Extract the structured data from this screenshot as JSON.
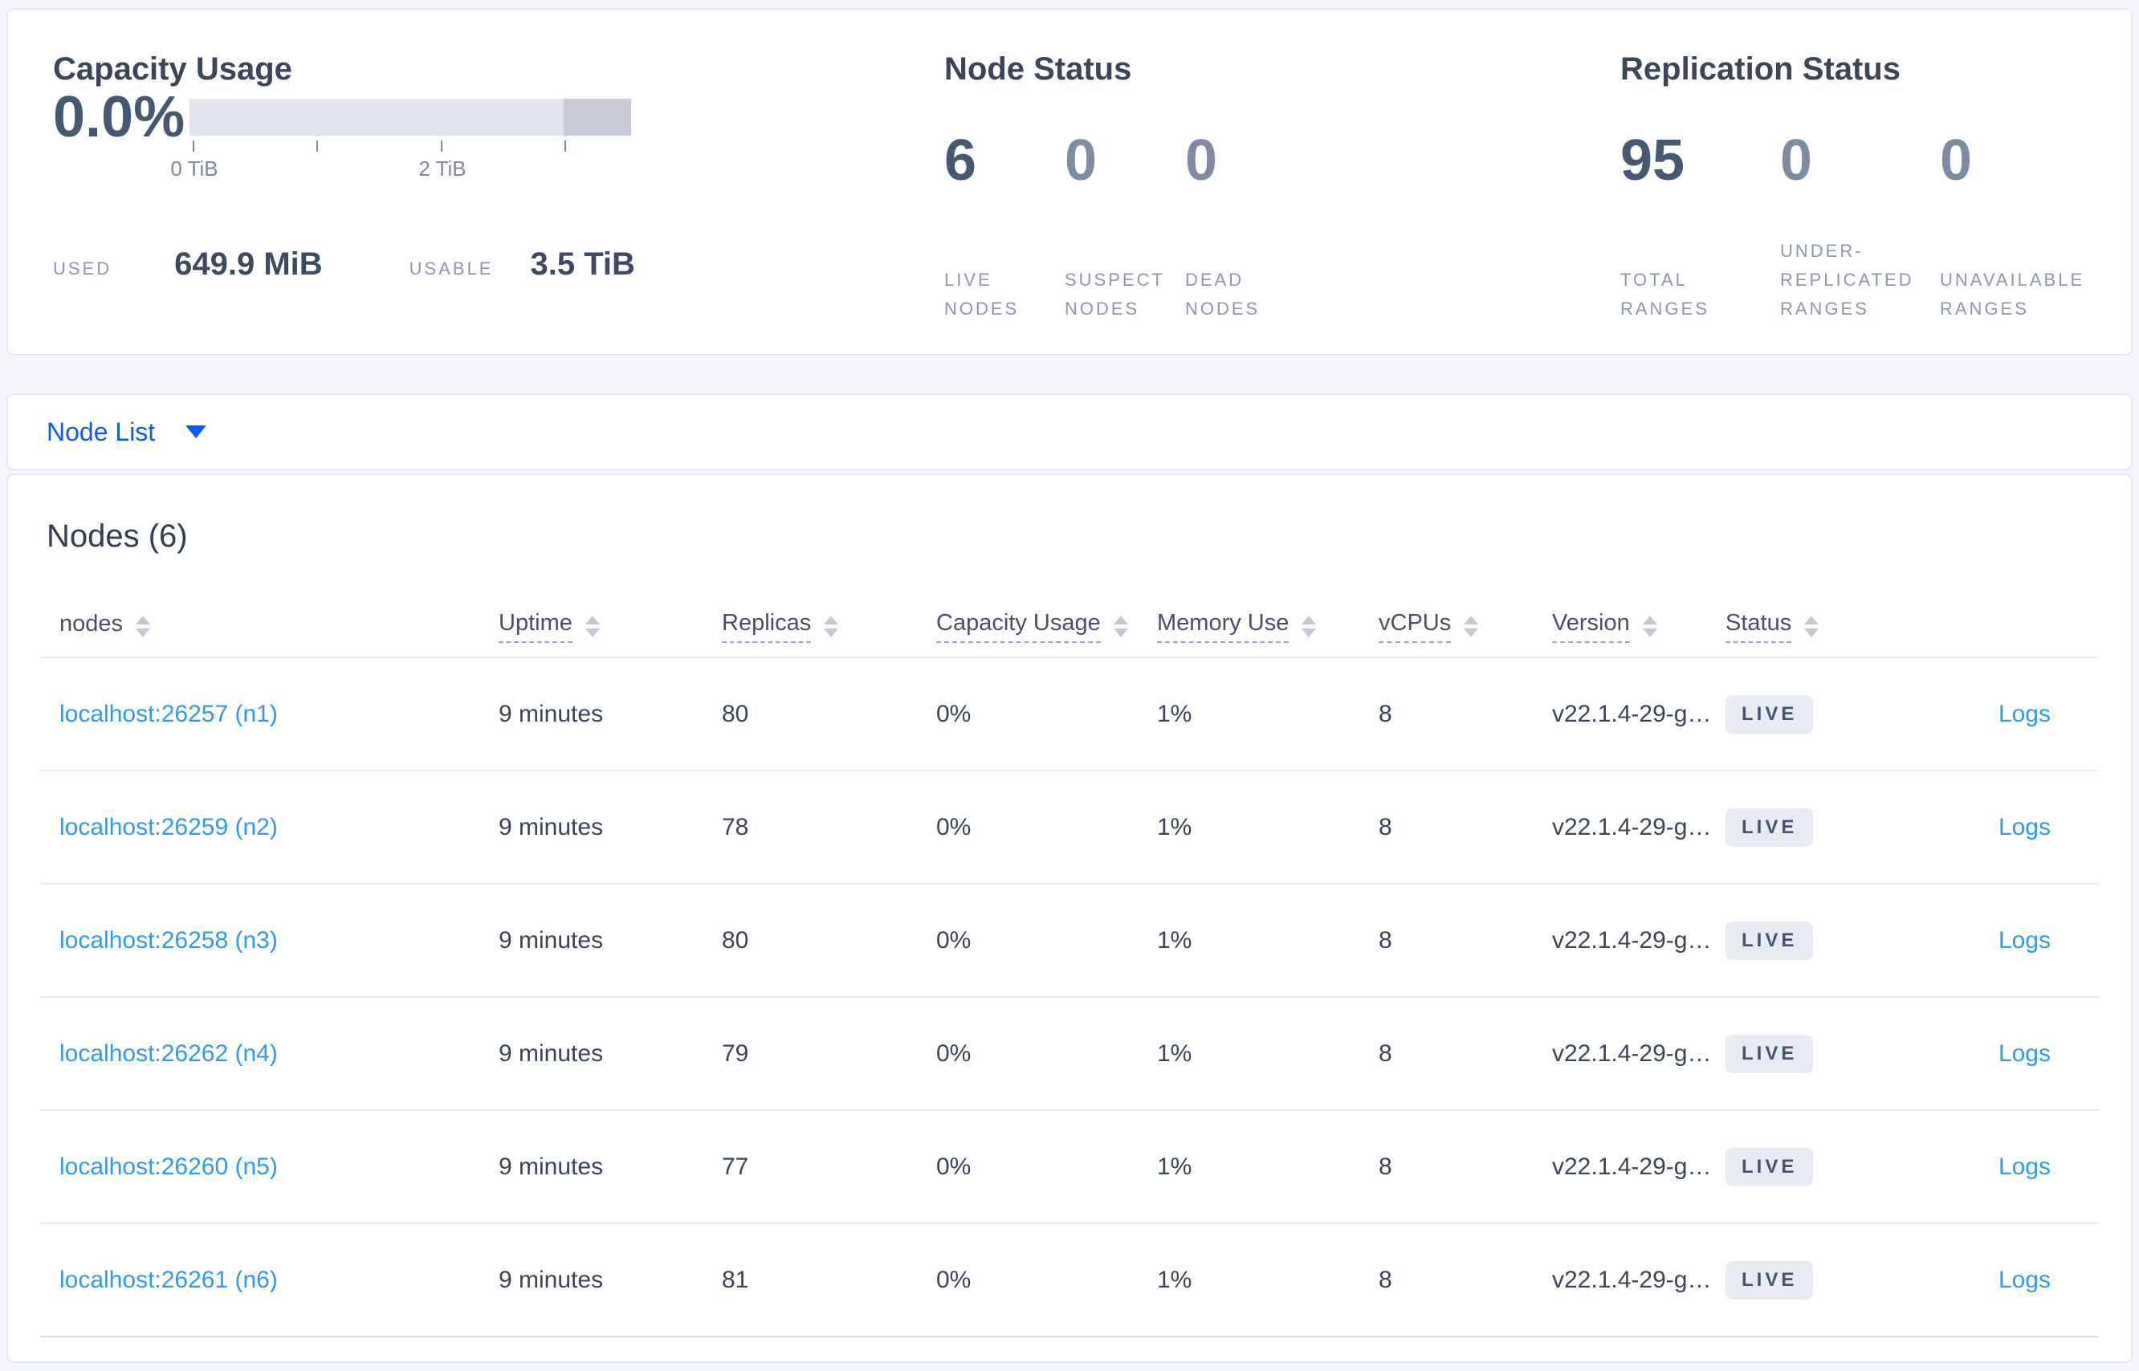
{
  "colors": {
    "page_background": "#f4f6fb",
    "card_background": "#ffffff",
    "heading_text": "#3b4659",
    "metric_emphasis": "#475872",
    "metric_muted": "#7e8ba3",
    "label_muted": "#8c96af",
    "selector_blue": "#0b5cf5",
    "link_blue": "#2d9af3",
    "bar_light": "#e3e6ed",
    "bar_dark": "#c9cdd8",
    "badge_background": "#e8ecf2",
    "badge_text": "#44536e"
  },
  "summary": {
    "capacity": {
      "title": "Capacity Usage",
      "percent": "0.0%",
      "tick_zero": "0 TiB",
      "tick_two": "2 TiB",
      "used_label": "USED",
      "used_value": "649.9 MiB",
      "usable_label": "USABLE",
      "usable_value": "3.5 TiB"
    },
    "node_status": {
      "title": "Node Status",
      "metrics": [
        {
          "value": "6",
          "label": "LIVE NODES"
        },
        {
          "value": "0",
          "label": "SUSPECT NODES"
        },
        {
          "value": "0",
          "label": "DEAD NODES"
        }
      ]
    },
    "replication": {
      "title": "Replication Status",
      "metrics": [
        {
          "value": "95",
          "label": "TOTAL RANGES"
        },
        {
          "value": "0",
          "label": "UNDER-REPLICATED RANGES"
        },
        {
          "value": "0",
          "label": "UNAVAILABLE RANGES"
        }
      ]
    }
  },
  "view_selector": {
    "label": "Node List"
  },
  "nodes_table": {
    "title": "Nodes (6)",
    "columns": [
      {
        "label": "nodes"
      },
      {
        "label": "Uptime"
      },
      {
        "label": "Replicas"
      },
      {
        "label": "Capacity Usage"
      },
      {
        "label": "Memory Use"
      },
      {
        "label": "vCPUs"
      },
      {
        "label": "Version"
      },
      {
        "label": "Status"
      }
    ],
    "rows": [
      {
        "node": "localhost:26257 (n1)",
        "uptime": "9 minutes",
        "replicas": "80",
        "capacity_usage": "0%",
        "memory_use": "1%",
        "vcpus": "8",
        "version": "v22.1.4-29-g…",
        "status": "LIVE",
        "logs": "Logs"
      },
      {
        "node": "localhost:26259 (n2)",
        "uptime": "9 minutes",
        "replicas": "78",
        "capacity_usage": "0%",
        "memory_use": "1%",
        "vcpus": "8",
        "version": "v22.1.4-29-g…",
        "status": "LIVE",
        "logs": "Logs"
      },
      {
        "node": "localhost:26258 (n3)",
        "uptime": "9 minutes",
        "replicas": "80",
        "capacity_usage": "0%",
        "memory_use": "1%",
        "vcpus": "8",
        "version": "v22.1.4-29-g…",
        "status": "LIVE",
        "logs": "Logs"
      },
      {
        "node": "localhost:26262 (n4)",
        "uptime": "9 minutes",
        "replicas": "79",
        "capacity_usage": "0%",
        "memory_use": "1%",
        "vcpus": "8",
        "version": "v22.1.4-29-g…",
        "status": "LIVE",
        "logs": "Logs"
      },
      {
        "node": "localhost:26260 (n5)",
        "uptime": "9 minutes",
        "replicas": "77",
        "capacity_usage": "0%",
        "memory_use": "1%",
        "vcpus": "8",
        "version": "v22.1.4-29-g…",
        "status": "LIVE",
        "logs": "Logs"
      },
      {
        "node": "localhost:26261 (n6)",
        "uptime": "9 minutes",
        "replicas": "81",
        "capacity_usage": "0%",
        "memory_use": "1%",
        "vcpus": "8",
        "version": "v22.1.4-29-g…",
        "status": "LIVE",
        "logs": "Logs"
      }
    ]
  }
}
